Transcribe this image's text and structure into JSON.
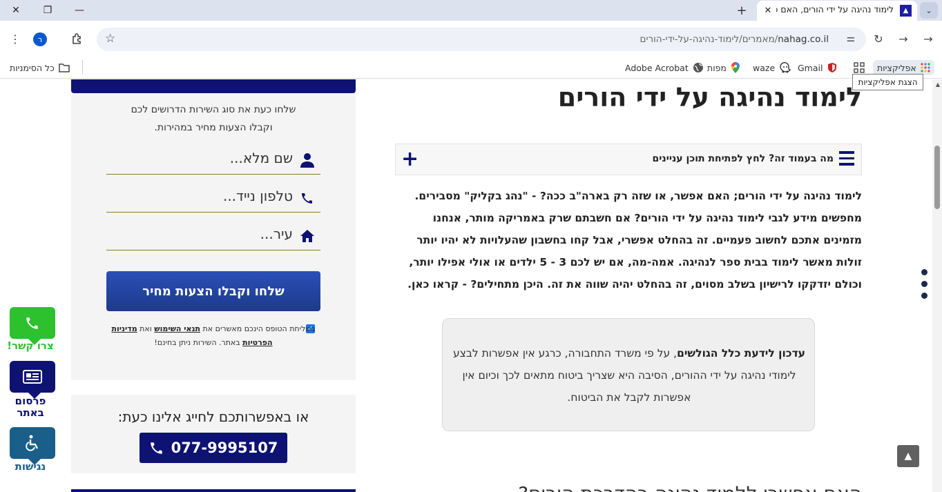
{
  "browser": {
    "tab_title": "לימוד נהיגה על ידי הורים, האם כ",
    "tab_favicon_icon": "nahag-triangle-icon",
    "url_path": "מאמרים/לימוד-נהיגה-על-ידי-הורים/",
    "url_domain": "nahag.co.il",
    "profile_initial": "ר",
    "bookmarks": {
      "all_bookmarks": "כל הסימניות",
      "adobe": "Adobe Acrobat",
      "maps": "מפות",
      "waze": "waze",
      "gmail": "Gmail",
      "apps": "אפליקציות"
    },
    "tooltip": "הצגת אפליקציות"
  },
  "sidebar": {
    "intro_line1": "שלחו כעת את סוג השירות הדרושים לכם",
    "intro_line2": "וקבלו הצעות מחיר במהירות.",
    "fields": {
      "name_placeholder": "שם מלא...",
      "phone_placeholder": "טלפון נייד...",
      "city_placeholder": "עיר..."
    },
    "submit_label": "שלחו וקבלו הצעות מחיר",
    "consent": {
      "checked": "true",
      "part1": "בשליחת הטופס הינכם מאשרים את ",
      "terms": "תנאי השימוש",
      "part2": " ואת ",
      "privacy": "מדיניות הפרטיות",
      "part3": " באתר. השירות ניתן בחינם!"
    },
    "call_title": "או באפשרותכם לחייג אלינו כעת:",
    "phone_number": "077-9995107"
  },
  "floating": {
    "contact": "צרו קשר!",
    "advertise_line1": "פרסום",
    "advertise_line2": "באתר",
    "accessibility": "נגישות",
    "colors": {
      "contact": "#2dc12d",
      "advertise": "#0d1273",
      "accessibility": "#1a5f8a"
    }
  },
  "article": {
    "title": "לימוד נהיגה על ידי הורים",
    "toc_label": "מה בעמוד זה? לחץ לפתיחת תוכן עניינים",
    "intro_paragraph": "לימוד נהיגה על ידי הורים; האם אפשר, או שזה רק בארה\"ב ככה? - \"נהג בקליק\" מסבירים. מחפשים מידע לגבי לימוד נהיגה על ידי הורים? אם חשבתם שרק באמריקה מותר, אנחנו מזמינים אתכם לחשוב פעמיים. זה בהחלט אפשרי, אבל קחו בחשבון שהעלויות לא יהיו יותר זולות מאשר לימוד בבית ספר לנהיגה. אמה-מה, אם יש לכם 3 - 5 ילדים או אולי אפילו יותר, וכולם יזדקקו לרישיון בשלב מסוים, זה בהחלט יהיה שווה את זה. היכן מתחילים? - קראו כאן.",
    "notice_bold": "עדכון לידעת כלל הגולשים",
    "notice_rest": ", על פי משרד התחבורה, כרגע אין אפשרות לבצע לימודי נהיגה על ידי ההורים, הסיבה היא שצריך ביטוח מתאים לכך וכיום אין אפשרות לקבל את הביטוח.",
    "next_heading": "האם אפשרי ללמוד נהיגה בהדרכת הורים?"
  },
  "colors": {
    "brand": "#0d1273",
    "accent_gold": "#8a7a1e"
  }
}
